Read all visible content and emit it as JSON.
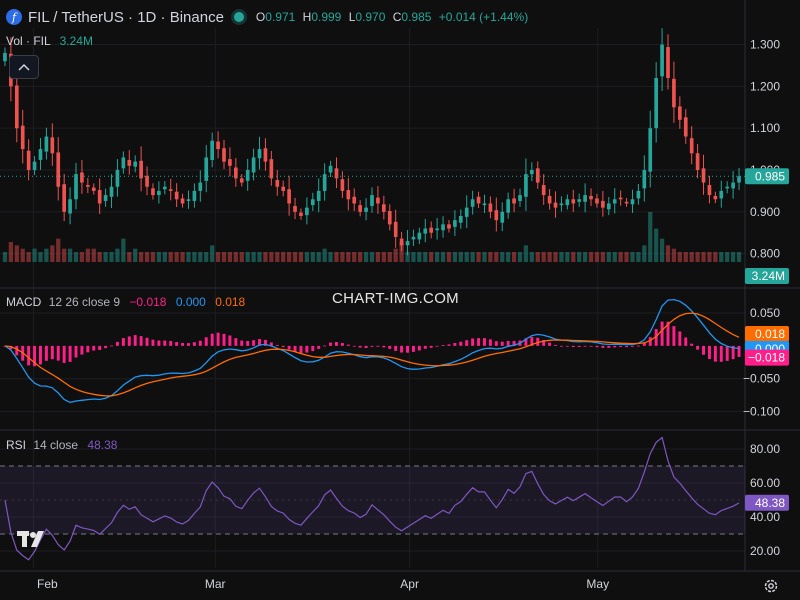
{
  "header": {
    "symbol_icon": "filecoin-icon",
    "title": "FIL / TetherUS · 1D · Binance",
    "ohlc": {
      "o_label": "O",
      "o": "0.971",
      "h_label": "H",
      "h": "0.999",
      "l_label": "L",
      "l": "0.970",
      "c_label": "C",
      "c": "0.985",
      "change": "+0.014 (+1.44%)"
    }
  },
  "volume_legend": {
    "name": "Vol · FIL",
    "value": "3.24M"
  },
  "macd_legend": {
    "name": "MACD",
    "params": "12 26 close 9",
    "hist": "−0.018",
    "macd": "0.000",
    "signal": "0.018"
  },
  "rsi_legend": {
    "name": "RSI",
    "params": "14 close",
    "value": "48.38"
  },
  "watermark": "CHART-IMG.COM",
  "colors": {
    "up": "#26a69a",
    "down": "#ef5350",
    "macd": "#2196f3",
    "signal": "#ff6d00",
    "hist": "#ff1f8a",
    "rsi": "#7e57c2"
  },
  "chart_data": [
    {
      "type": "candlestick",
      "title": "FIL / TetherUS · 1D · Binance",
      "x_axis": {
        "type": "date",
        "start": "2024-01-27",
        "end": "2024-05-24",
        "tick_labels": [
          "Feb",
          "Mar",
          "Apr",
          "May"
        ],
        "tick_dates": [
          "2024-02-01",
          "2024-03-01",
          "2024-04-01",
          "2024-05-01"
        ]
      },
      "y_axis": {
        "ticks": [
          "0.800",
          "0.900",
          "1.000",
          "1.100",
          "1.200",
          "1.300"
        ],
        "range": [
          0.78,
          1.33
        ]
      },
      "last_price": "0.985",
      "closes": [
        1.28,
        1.2,
        1.1,
        1.05,
        1.0,
        1.02,
        1.05,
        1.08,
        1.04,
        0.96,
        0.9,
        0.93,
        0.99,
        0.97,
        0.96,
        0.95,
        0.92,
        0.94,
        0.96,
        1.0,
        1.03,
        1.01,
        1.02,
        0.98,
        0.96,
        0.94,
        0.95,
        0.96,
        0.95,
        0.93,
        0.92,
        0.93,
        0.95,
        0.97,
        1.03,
        1.07,
        1.05,
        1.02,
        1.01,
        0.98,
        0.97,
        1.0,
        1.03,
        1.05,
        1.02,
        0.98,
        0.96,
        0.95,
        0.92,
        0.9,
        0.89,
        0.91,
        0.93,
        0.95,
        0.99,
        1.01,
        0.98,
        0.95,
        0.93,
        0.92,
        0.9,
        0.91,
        0.94,
        0.92,
        0.9,
        0.87,
        0.84,
        0.82,
        0.83,
        0.84,
        0.85,
        0.86,
        0.85,
        0.86,
        0.87,
        0.86,
        0.88,
        0.89,
        0.91,
        0.93,
        0.92,
        0.92,
        0.9,
        0.88,
        0.9,
        0.93,
        0.92,
        0.94,
        0.99,
        1.0,
        0.97,
        0.94,
        0.92,
        0.91,
        0.92,
        0.93,
        0.92,
        0.93,
        0.94,
        0.93,
        0.92,
        0.91,
        0.92,
        0.93,
        0.93,
        0.92,
        0.93,
        0.95,
        1.0,
        1.1,
        1.22,
        1.3,
        1.22,
        1.15,
        1.12,
        1.08,
        1.04,
        1.0,
        0.97,
        0.94,
        0.93,
        0.95,
        0.96,
        0.97,
        0.985
      ]
    },
    {
      "type": "bar",
      "title": "Vol · FIL",
      "last_value": "3.24M",
      "relative_values": [
        3,
        6,
        5,
        4,
        3,
        4,
        3,
        4,
        5,
        7,
        4,
        4,
        3,
        3,
        4,
        4,
        3,
        3,
        3,
        4,
        7,
        3,
        4,
        3,
        3,
        3,
        3,
        3,
        3,
        3,
        3,
        3,
        3,
        3,
        3,
        5,
        3,
        3,
        3,
        3,
        3,
        3,
        3,
        3,
        3,
        3,
        3,
        3,
        3,
        3,
        3,
        3,
        3,
        3,
        4,
        3,
        3,
        3,
        3,
        3,
        3,
        3,
        3,
        3,
        3,
        3,
        4,
        6,
        3,
        3,
        3,
        3,
        3,
        3,
        3,
        3,
        3,
        3,
        3,
        3,
        3,
        3,
        3,
        3,
        3,
        3,
        3,
        3,
        5,
        3,
        3,
        3,
        3,
        3,
        3,
        3,
        3,
        3,
        3,
        3,
        3,
        3,
        3,
        3,
        3,
        3,
        3,
        3,
        5,
        15,
        10,
        7,
        5,
        4,
        3,
        3,
        3,
        3,
        3,
        3,
        3,
        3,
        3,
        3,
        3
      ]
    },
    {
      "type": "line",
      "title": "MACD 12 26 close 9",
      "y_axis": {
        "ticks": [
          "−0.100",
          "−0.050",
          "0.050"
        ],
        "range": [
          -0.125,
          0.085
        ]
      },
      "series": [
        {
          "name": "MACD",
          "last": "0.000"
        },
        {
          "name": "Signal",
          "last": "0.018"
        },
        {
          "name": "Histogram",
          "last": "−0.018"
        }
      ]
    },
    {
      "type": "line",
      "title": "RSI 14 close",
      "y_axis": {
        "ticks": [
          "20.00",
          "40.00",
          "60.00",
          "80.00"
        ],
        "range": [
          10,
          90
        ]
      },
      "bands": [
        30,
        70
      ],
      "last_value": "48.38"
    }
  ]
}
